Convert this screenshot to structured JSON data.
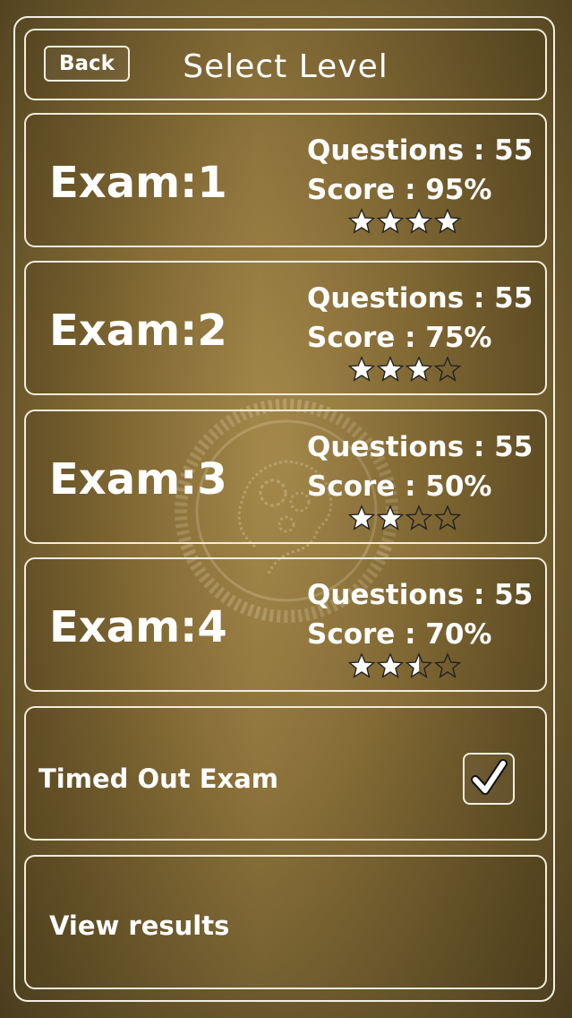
{
  "header": {
    "back_label": "Back",
    "title": "Select Level"
  },
  "exams": [
    {
      "label": "Exam:1",
      "questions": "Questions : 55",
      "score": "Score : 95%",
      "rating": 4,
      "max_rating": 4
    },
    {
      "label": "Exam:2",
      "questions": "Questions : 55",
      "score": "Score : 75%",
      "rating": 3,
      "max_rating": 4
    },
    {
      "label": "Exam:3",
      "questions": "Questions : 55",
      "score": "Score : 50%",
      "rating": 2,
      "max_rating": 4
    },
    {
      "label": "Exam:4",
      "questions": "Questions : 55",
      "score": "Score : 70%",
      "rating": 2.5,
      "max_rating": 4
    }
  ],
  "timed": {
    "label": "Timed Out Exam",
    "checked": true
  },
  "view_results": {
    "label": "View results"
  },
  "icons": {
    "watermark": "brain-gears-icon",
    "check": "checkmark-icon",
    "star": "star-icon"
  },
  "colors": {
    "border": "#f3efe2",
    "star_fill": "#ffffff",
    "star_outline": "#222222"
  }
}
